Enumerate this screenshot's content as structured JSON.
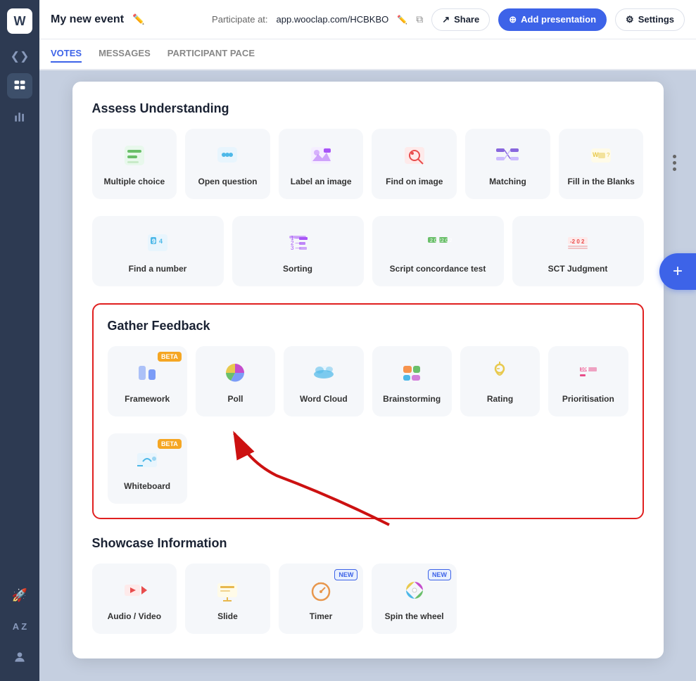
{
  "app": {
    "logo": "W",
    "event_title": "My new event",
    "participate_label": "Participate at:",
    "participate_url": "app.wooclap.com/HCBKBO",
    "settings_label": "Settings",
    "share_label": "Share",
    "add_presentation_label": "Add presentation"
  },
  "nav": {
    "tabs": [
      {
        "id": "votes",
        "label": "VOTES",
        "active": true
      },
      {
        "id": "messages",
        "label": "MESSAGES",
        "active": false
      },
      {
        "id": "participant-pace",
        "label": "PARTICIPANT PACE",
        "active": false
      }
    ]
  },
  "sections": {
    "assess": {
      "title": "Assess Understanding",
      "items_row1": [
        {
          "id": "multiple-choice",
          "label": "Multiple choice",
          "icon": "mc",
          "badge": null
        },
        {
          "id": "open-question",
          "label": "Open question",
          "icon": "oq",
          "badge": null
        },
        {
          "id": "label-image",
          "label": "Label an image",
          "icon": "li",
          "badge": null
        },
        {
          "id": "find-on-image",
          "label": "Find on image",
          "icon": "fi",
          "badge": null
        },
        {
          "id": "matching",
          "label": "Matching",
          "icon": "ma",
          "badge": null
        },
        {
          "id": "fill-blanks",
          "label": "Fill in the Blanks",
          "icon": "fb",
          "badge": null
        }
      ],
      "items_row2": [
        {
          "id": "find-number",
          "label": "Find a number",
          "icon": "fn",
          "badge": null
        },
        {
          "id": "sorting",
          "label": "Sorting",
          "icon": "so",
          "badge": null
        },
        {
          "id": "script-concordance",
          "label": "Script concordance test",
          "icon": "sc",
          "badge": null
        },
        {
          "id": "sct-judgment",
          "label": "SCT Judgment",
          "icon": "sj",
          "badge": null
        }
      ]
    },
    "gather": {
      "title": "Gather Feedback",
      "items_row1": [
        {
          "id": "framework",
          "label": "Framework",
          "icon": "fw",
          "badge": "BETA"
        },
        {
          "id": "poll",
          "label": "Poll",
          "icon": "po",
          "badge": null
        },
        {
          "id": "word-cloud",
          "label": "Word Cloud",
          "icon": "wc",
          "badge": null
        },
        {
          "id": "brainstorming",
          "label": "Brainstorming",
          "icon": "br",
          "badge": null
        },
        {
          "id": "rating",
          "label": "Rating",
          "icon": "ra",
          "badge": null
        },
        {
          "id": "prioritisation",
          "label": "Prioritisation",
          "icon": "pr",
          "badge": null
        }
      ],
      "items_row2": [
        {
          "id": "whiteboard",
          "label": "Whiteboard",
          "icon": "wb",
          "badge": "BETA"
        }
      ]
    },
    "showcase": {
      "title": "Showcase Information",
      "items": [
        {
          "id": "audio-video",
          "label": "Audio / Video",
          "icon": "av",
          "badge": null
        },
        {
          "id": "slide",
          "label": "Slide",
          "icon": "sl",
          "badge": null
        },
        {
          "id": "timer",
          "label": "Timer",
          "icon": "ti",
          "badge": "NEW"
        },
        {
          "id": "spin-wheel",
          "label": "Spin the wheel",
          "icon": "sw",
          "badge": "NEW"
        }
      ]
    }
  },
  "icons": {
    "colors": {
      "mc": "#6abf6a",
      "oq": "#4db8e8",
      "li": "#a855f7",
      "fi": "#e84d4d",
      "ma": "#8866dd",
      "fb": "#e8c94d",
      "fn": "#4db8e8",
      "so": "#a855f7",
      "sc": "#6abf6a",
      "sj": "#e84d4d",
      "fw": "#7b9cf7",
      "po": "#c44dcc",
      "wc": "#4db8e8",
      "br": "#f7934d",
      "ra": "#e8c94d",
      "pr": "#e84d8a",
      "wb": "#4db8e8",
      "av": "#e84d4d",
      "sl": "#e8b84d",
      "ti": "#e8974d",
      "sw": "#c44dcc"
    }
  }
}
